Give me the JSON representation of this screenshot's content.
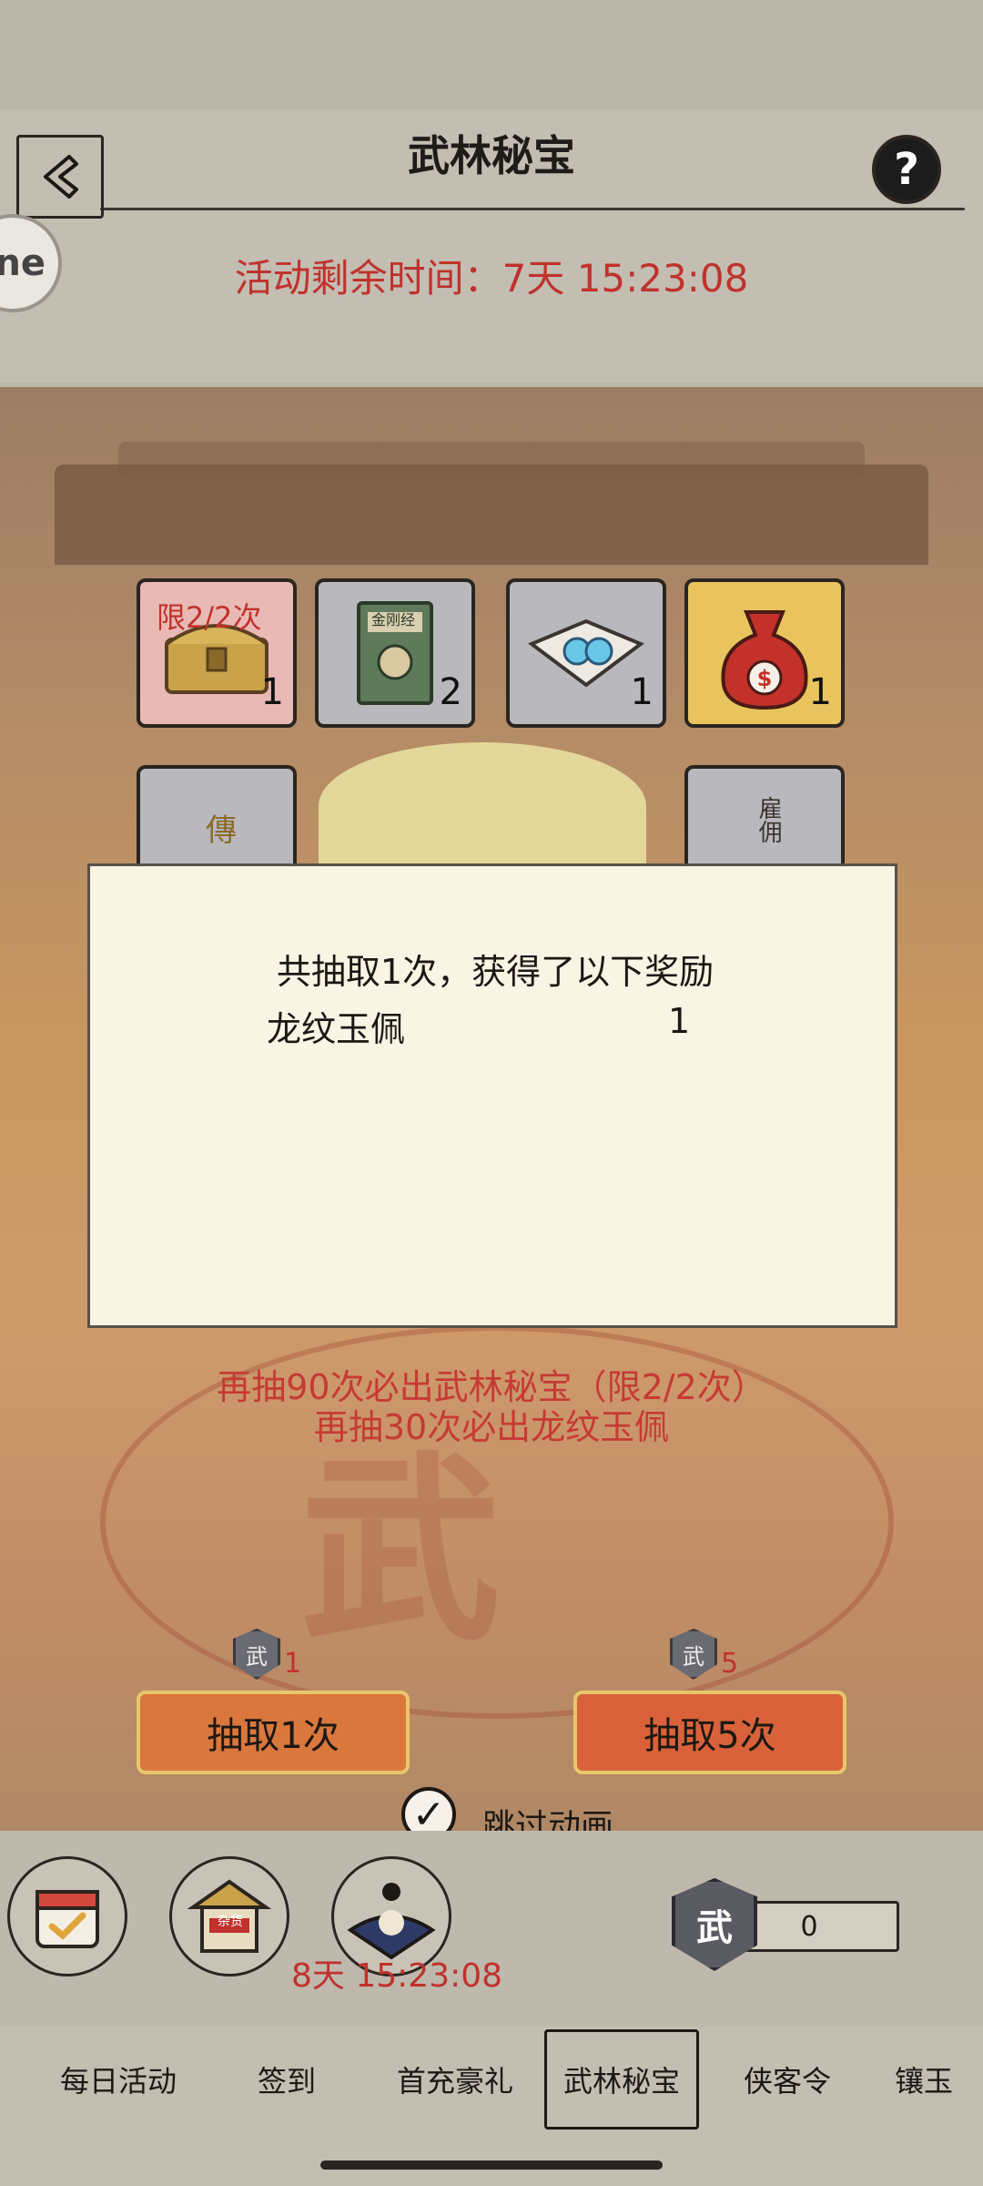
{
  "header": {
    "title": "武林秘宝"
  },
  "side_badge_text": "ne",
  "event_timer": {
    "label": "活动剩余时间：",
    "value": "7天 15:23:08"
  },
  "reward_slots": [
    {
      "tag": "限2/2次",
      "count": "1"
    },
    {
      "book_text": "金刚经",
      "count": "2"
    },
    {
      "count": "1"
    },
    {
      "count": "1"
    }
  ],
  "reward_slots_row2": [
    {
      "glyph": "傳"
    },
    {
      "text": "雇佣"
    }
  ],
  "dialog": {
    "title": "共抽取1次，获得了以下奖励",
    "rewards": [
      {
        "name": "龙纹玉佩",
        "qty": "1"
      }
    ]
  },
  "pity": {
    "line1": "再抽90次必出武林秘宝（限2/2次）",
    "line2": "再抽30次必出龙纹玉佩"
  },
  "draw_buttons": [
    {
      "label": "抽取1次",
      "cost": "1",
      "icon_text": "武"
    },
    {
      "label": "抽取5次",
      "cost": "5",
      "icon_text": "武"
    }
  ],
  "skip_animation": {
    "label": "跳过动画",
    "checked": true
  },
  "bottom": {
    "timer": "8天 15:23:08",
    "shop_sign": "杂货",
    "currency": {
      "icon_text": "武",
      "amount": "0"
    }
  },
  "tabs": [
    {
      "label": "每日活动",
      "active": false
    },
    {
      "label": "签到",
      "active": false
    },
    {
      "label": "首充豪礼",
      "active": false
    },
    {
      "label": "武林秘宝",
      "active": true
    },
    {
      "label": "侠客令",
      "active": false
    },
    {
      "label": "镶玉",
      "active": false
    }
  ],
  "colors": {
    "accent_red": "#c0322c",
    "dialog_bg": "#faf4e4",
    "button_orange": "#d9733c"
  }
}
